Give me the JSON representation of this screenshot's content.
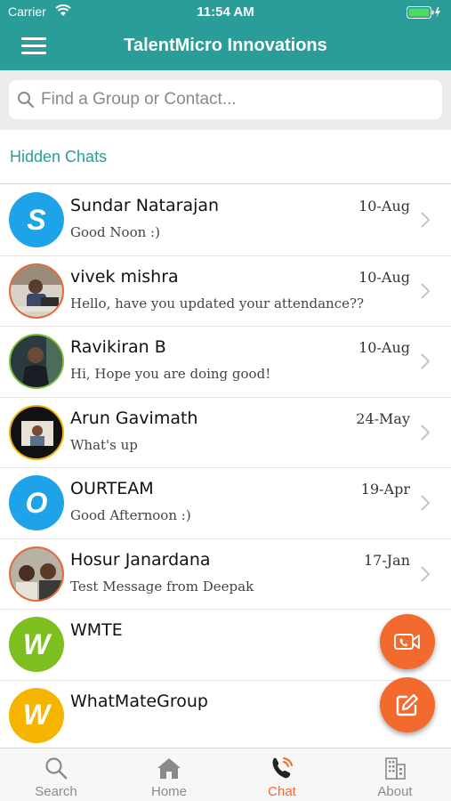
{
  "status": {
    "carrier": "Carrier",
    "time": "11:54 AM"
  },
  "header": {
    "title": "TalentMicro Innovations",
    "menu_icon": "hamburger-menu-icon"
  },
  "search": {
    "placeholder": "Find a Group or Contact..."
  },
  "hidden_chats_label": "Hidden Chats",
  "chats": [
    {
      "name": "Sundar Natarajan",
      "date": "10-Aug",
      "message": "Good Noon :)",
      "avatar_letter": "S",
      "avatar_color": "#1ea3e8"
    },
    {
      "name": "vivek mishra",
      "date": "10-Aug",
      "message": "Hello, have you updated your attendance??"
    },
    {
      "name": "Ravikiran B",
      "date": "10-Aug",
      "message": "Hi, Hope you are doing good!"
    },
    {
      "name": "Arun Gavimath",
      "date": "24-May",
      "message": "What's up"
    },
    {
      "name": "OURTEAM",
      "date": "19-Apr",
      "message": "Good Afternoon :)",
      "avatar_letter": "O",
      "avatar_color": "#1ea3e8"
    },
    {
      "name": "Hosur Janardana",
      "date": "17-Jan",
      "message": "Test Message from Deepak"
    },
    {
      "name": "WMTE",
      "date": "",
      "message": "",
      "avatar_letter": "W",
      "avatar_color": "#7cbf1f"
    },
    {
      "name": "WhatMateGroup",
      "date": "",
      "message": "",
      "avatar_letter": "W",
      "avatar_color": "#f5b400"
    }
  ],
  "tabs": [
    {
      "label": "Search",
      "icon": "search-icon"
    },
    {
      "label": "Home",
      "icon": "home-icon"
    },
    {
      "label": "Chat",
      "icon": "chat-phone-icon",
      "active": true
    },
    {
      "label": "About",
      "icon": "building-icon"
    }
  ],
  "colors": {
    "teal": "#2a9d98",
    "accent_orange": "#f26a2d"
  }
}
